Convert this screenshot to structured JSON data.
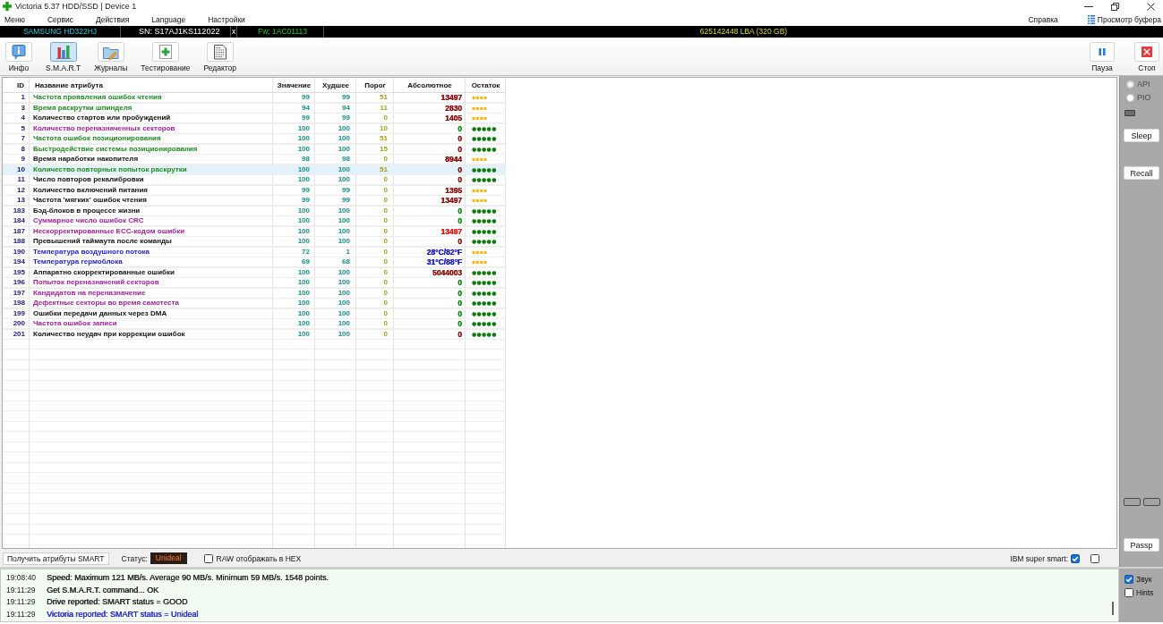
{
  "window": {
    "title": "Victoria 5.37 HDD/SSD | Device 1"
  },
  "menu": {
    "items": [
      "Меню",
      "Сервис",
      "Действия",
      "Language",
      "Настройки"
    ],
    "help": "Справка",
    "buffer_view": "Просмотр буфера"
  },
  "device_bar": {
    "model": "SAMSUNG HD322HJ",
    "serial": "SN: S17AJ1KS112022",
    "close": "x",
    "firmware": "Fw: 1AC01113",
    "capacity": "625142448 LBA (320 GB)"
  },
  "toolbar": {
    "tabs": [
      {
        "label": "Инфо",
        "kind": "info",
        "selected": false
      },
      {
        "label": "S.M.A.R.T",
        "kind": "smart",
        "selected": true
      },
      {
        "label": "Журналы",
        "kind": "logs",
        "selected": false
      },
      {
        "label": "Тестирование",
        "kind": "test",
        "selected": false
      },
      {
        "label": "Редактор",
        "kind": "editor",
        "selected": false
      }
    ],
    "actions": [
      {
        "label": "Пауза",
        "kind": "pause"
      },
      {
        "label": "Стоп",
        "kind": "stop"
      }
    ]
  },
  "table": {
    "columns": [
      "ID",
      "Название атрибута",
      "Значение",
      "Худшее",
      "Порог",
      "Абсолютное",
      "Остаток"
    ],
    "rows": [
      {
        "id": "1",
        "name": {
          "text": "Частота проявления ошибок чтения",
          "color": "#1e8c1e"
        },
        "value": "99",
        "worst": "99",
        "threshold": "51",
        "raw": {
          "text": "13497",
          "color": "#8b1010"
        },
        "remaining": {
          "text": "▪▪▪▪",
          "color": "#f2b600"
        },
        "selected": false
      },
      {
        "id": "3",
        "name": {
          "text": "Время раскрутки шпинделя",
          "color": "#1e8c1e"
        },
        "value": "94",
        "worst": "94",
        "threshold": "11",
        "raw": {
          "text": "2830",
          "color": "#8b1010"
        },
        "remaining": {
          "text": "▪▪▪▪",
          "color": "#f2b600"
        },
        "selected": false
      },
      {
        "id": "4",
        "name": {
          "text": "Количество стартов или пробуждений",
          "color": "#111111"
        },
        "value": "99",
        "worst": "99",
        "threshold": "0",
        "raw": {
          "text": "1405",
          "color": "#8b1010"
        },
        "remaining": {
          "text": "▪▪▪▪",
          "color": "#f2b600"
        },
        "selected": false
      },
      {
        "id": "5",
        "name": {
          "text": "Количество переназначенных секторов",
          "color": "#a01e9c"
        },
        "value": "100",
        "worst": "100",
        "threshold": "10",
        "raw": {
          "text": "0",
          "color": "#0c8c0c"
        },
        "remaining": {
          "text": "●●●●●",
          "color": "#0a7a0a"
        },
        "selected": false
      },
      {
        "id": "7",
        "name": {
          "text": "Частота ошибок позиционирования",
          "color": "#1e8c1e"
        },
        "value": "100",
        "worst": "100",
        "threshold": "51",
        "raw": {
          "text": "0",
          "color": "#8b1010"
        },
        "remaining": {
          "text": "●●●●●",
          "color": "#0a7a0a"
        },
        "selected": false
      },
      {
        "id": "8",
        "name": {
          "text": "Быстродействие системы позиционирования",
          "color": "#1e8c1e"
        },
        "value": "100",
        "worst": "100",
        "threshold": "15",
        "raw": {
          "text": "0",
          "color": "#8b1010"
        },
        "remaining": {
          "text": "●●●●●",
          "color": "#0a7a0a"
        },
        "selected": false
      },
      {
        "id": "9",
        "name": {
          "text": "Время наработки накопителя",
          "color": "#111111"
        },
        "value": "98",
        "worst": "98",
        "threshold": "0",
        "raw": {
          "text": "8944",
          "color": "#8b1010"
        },
        "remaining": {
          "text": "▪▪▪▪",
          "color": "#f2b600"
        },
        "selected": false
      },
      {
        "id": "10",
        "name": {
          "text": "Количество повторных попыток раскрутки",
          "color": "#1e8c1e"
        },
        "value": "100",
        "worst": "100",
        "threshold": "51",
        "raw": {
          "text": "0",
          "color": "#8b1010"
        },
        "remaining": {
          "text": "●●●●●",
          "color": "#0a7a0a"
        },
        "selected": true
      },
      {
        "id": "11",
        "name": {
          "text": "Число повторов рекалибровки",
          "color": "#111111"
        },
        "value": "100",
        "worst": "100",
        "threshold": "0",
        "raw": {
          "text": "0",
          "color": "#8b1010"
        },
        "remaining": {
          "text": "●●●●●",
          "color": "#0a7a0a"
        },
        "selected": false
      },
      {
        "id": "12",
        "name": {
          "text": "Количество включений питания",
          "color": "#111111"
        },
        "value": "99",
        "worst": "99",
        "threshold": "0",
        "raw": {
          "text": "1395",
          "color": "#8b1010"
        },
        "remaining": {
          "text": "▪▪▪▪",
          "color": "#f2b600"
        },
        "selected": false
      },
      {
        "id": "13",
        "name": {
          "text": "Частота 'мягких' ошибок чтения",
          "color": "#111111"
        },
        "value": "99",
        "worst": "99",
        "threshold": "0",
        "raw": {
          "text": "13497",
          "color": "#8b1010"
        },
        "remaining": {
          "text": "▪▪▪▪",
          "color": "#f2b600"
        },
        "selected": false
      },
      {
        "id": "183",
        "name": {
          "text": "Бэд-блоков в процессе жизни",
          "color": "#111111"
        },
        "value": "100",
        "worst": "100",
        "threshold": "0",
        "raw": {
          "text": "0",
          "color": "#0c8c0c"
        },
        "remaining": {
          "text": "●●●●●",
          "color": "#0a7a0a"
        },
        "selected": false
      },
      {
        "id": "184",
        "name": {
          "text": "Суммарное число ошибок CRC",
          "color": "#a01e9c"
        },
        "value": "100",
        "worst": "100",
        "threshold": "0",
        "raw": {
          "text": "0",
          "color": "#0c8c0c"
        },
        "remaining": {
          "text": "●●●●●",
          "color": "#0a7a0a"
        },
        "selected": false
      },
      {
        "id": "187",
        "name": {
          "text": "Нескорректированные ECC-кодом ошибки",
          "color": "#a01e9c"
        },
        "value": "100",
        "worst": "100",
        "threshold": "0",
        "raw": {
          "text": "13497",
          "color": "#e01818"
        },
        "remaining": {
          "text": "●●●●●",
          "color": "#0a7a0a"
        },
        "selected": false
      },
      {
        "id": "188",
        "name": {
          "text": "Превышений таймаута после команды",
          "color": "#111111"
        },
        "value": "100",
        "worst": "100",
        "threshold": "0",
        "raw": {
          "text": "0",
          "color": "#8b1010"
        },
        "remaining": {
          "text": "●●●●●",
          "color": "#0a7a0a"
        },
        "selected": false
      },
      {
        "id": "190",
        "name": {
          "text": "Температура воздушного потока",
          "color": "#1d1dc8"
        },
        "value": "72",
        "worst": "1",
        "threshold": "0",
        "raw": {
          "text": "28°C/82°F",
          "color": "#1d1dc8"
        },
        "remaining": {
          "text": "▪▪▪▪",
          "color": "#f2b600"
        },
        "selected": false
      },
      {
        "id": "194",
        "name": {
          "text": "Температура гермоблока",
          "color": "#1d1dc8"
        },
        "value": "69",
        "worst": "68",
        "threshold": "0",
        "raw": {
          "text": "31°C/88°F",
          "color": "#1d1dc8"
        },
        "remaining": {
          "text": "▪▪▪▪",
          "color": "#f2b600"
        },
        "selected": false
      },
      {
        "id": "195",
        "name": {
          "text": "Аппаратно скорректированные ошибки",
          "color": "#111111"
        },
        "value": "100",
        "worst": "100",
        "threshold": "0",
        "raw": {
          "text": "5044003",
          "color": "#8b1010"
        },
        "remaining": {
          "text": "●●●●●",
          "color": "#0a7a0a"
        },
        "selected": false
      },
      {
        "id": "196",
        "name": {
          "text": "Попыток переназначений секторов",
          "color": "#a01e9c"
        },
        "value": "100",
        "worst": "100",
        "threshold": "0",
        "raw": {
          "text": "0",
          "color": "#0c8c0c"
        },
        "remaining": {
          "text": "●●●●●",
          "color": "#0a7a0a"
        },
        "selected": false
      },
      {
        "id": "197",
        "name": {
          "text": "Кандидатов на переназначение",
          "color": "#a01e9c"
        },
        "value": "100",
        "worst": "100",
        "threshold": "0",
        "raw": {
          "text": "0",
          "color": "#0c8c0c"
        },
        "remaining": {
          "text": "●●●●●",
          "color": "#0a7a0a"
        },
        "selected": false
      },
      {
        "id": "198",
        "name": {
          "text": "Дефектные секторы во время самотеста",
          "color": "#a01e9c"
        },
        "value": "100",
        "worst": "100",
        "threshold": "0",
        "raw": {
          "text": "0",
          "color": "#0c8c0c"
        },
        "remaining": {
          "text": "●●●●●",
          "color": "#0a7a0a"
        },
        "selected": false
      },
      {
        "id": "199",
        "name": {
          "text": "Ошибки передачи данных через DMA",
          "color": "#111111"
        },
        "value": "100",
        "worst": "100",
        "threshold": "0",
        "raw": {
          "text": "0",
          "color": "#0c8c0c"
        },
        "remaining": {
          "text": "●●●●●",
          "color": "#0a7a0a"
        },
        "selected": false
      },
      {
        "id": "200",
        "name": {
          "text": "Частота ошибок записи",
          "color": "#a01e9c"
        },
        "value": "100",
        "worst": "100",
        "threshold": "0",
        "raw": {
          "text": "0",
          "color": "#0c8c0c"
        },
        "remaining": {
          "text": "●●●●●",
          "color": "#0a7a0a"
        },
        "selected": false
      },
      {
        "id": "201",
        "name": {
          "text": "Количество неудач при коррекции ошибок",
          "color": "#111111"
        },
        "value": "100",
        "worst": "100",
        "threshold": "0",
        "raw": {
          "text": "0",
          "color": "#8b1010"
        },
        "remaining": {
          "text": "●●●●●",
          "color": "#0a7a0a"
        },
        "selected": false
      }
    ]
  },
  "smart_bar": {
    "get_button": "Получить атрибуты SMART",
    "status_label": "Статус:",
    "status_value": "Unideal",
    "raw_hex": {
      "label": "RAW отображать в HEX",
      "checked": false
    },
    "ibm_super_smart": {
      "label": "IBM super smart:",
      "checked": true
    },
    "unlabeled_checkbox": {
      "checked": false
    }
  },
  "sidebar": {
    "modes": [
      {
        "label": "API",
        "selected": true,
        "disabled": true
      },
      {
        "label": "PIO",
        "selected": false,
        "disabled": true
      }
    ],
    "buttons": [
      "Sleep",
      "Recall"
    ],
    "passp_button": "Passp"
  },
  "log": [
    {
      "time": "19:08:40",
      "text": "Speed: Maximum 121 MB/s. Average 90 MB/s. Minimum 59 MB/s. 1548 points.",
      "color": "#222222"
    },
    {
      "time": "19:11:29",
      "text": "Get S.M.A.R.T. command... OK",
      "color": "#222222"
    },
    {
      "time": "19:11:29",
      "text": "Drive reported: SMART status = GOOD",
      "color": "#222222"
    },
    {
      "time": "19:11:29",
      "text": "Victoria reported: SMART status = Unideal",
      "color": "#2424c8"
    }
  ],
  "options": [
    {
      "label": "Звук",
      "checked": true
    },
    {
      "label": "Hints",
      "checked": false
    }
  ]
}
